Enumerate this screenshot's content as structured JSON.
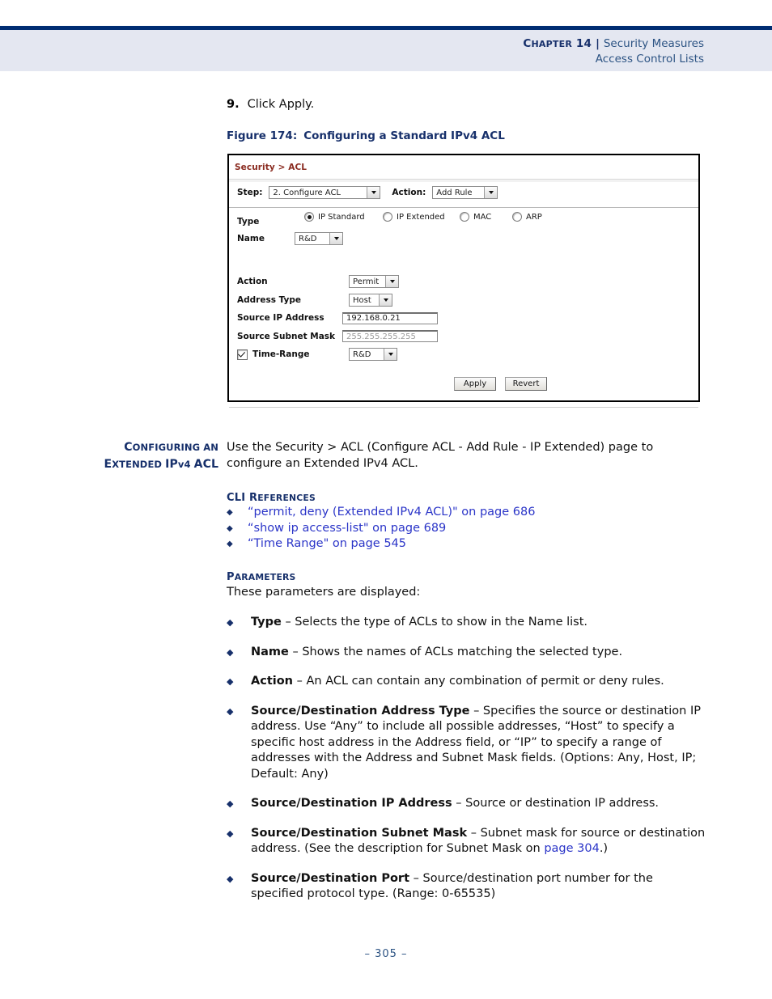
{
  "header": {
    "chapter": "CHAPTER 14",
    "separator": "|",
    "topic": "Security Measures",
    "subtopic": "Access Control Lists"
  },
  "step": {
    "number": "9.",
    "text": "Click Apply."
  },
  "figure": {
    "number": "Figure 174:",
    "title": "Configuring a Standard IPv4 ACL"
  },
  "screenshot": {
    "breadcrumb": "Security > ACL",
    "step_label": "Step:",
    "step_value": "2. Configure ACL",
    "action_label": "Action:",
    "action_value": "Add Rule",
    "type_label": "Type",
    "type_options": [
      {
        "label": "IP Standard",
        "selected": true
      },
      {
        "label": "IP Extended",
        "selected": false
      },
      {
        "label": "MAC",
        "selected": false
      },
      {
        "label": "ARP",
        "selected": false
      }
    ],
    "name_label": "Name",
    "name_value": "R&D",
    "fields": [
      {
        "label": "Action",
        "kind": "select",
        "value": "Permit",
        "width": "w-permit"
      },
      {
        "label": "Address Type",
        "kind": "select",
        "value": "Host",
        "width": "w-host"
      },
      {
        "label": "Source IP Address",
        "kind": "text",
        "value": "192.168.0.21",
        "disabled": false
      },
      {
        "label": "Source Subnet Mask",
        "kind": "text",
        "value": "255.255.255.255",
        "disabled": true
      }
    ],
    "time_range_label": "Time-Range",
    "time_range_checked": true,
    "time_range_value": "R&D",
    "apply_button": "Apply",
    "revert_button": "Revert"
  },
  "side_heading": {
    "line1": "CONFIGURING AN",
    "line2": "EXTENDED IPv4 ACL"
  },
  "intro": "Use the Security > ACL (Configure ACL - Add Rule - IP Extended) page to configure an Extended IPv4 ACL.",
  "cli_references": {
    "heading": "CLI REFERENCES",
    "items": [
      "“permit, deny (Extended IPv4 ACL)\" on page 686",
      "“show ip access-list\" on page 689",
      "“Time Range\" on page 545"
    ]
  },
  "parameters": {
    "heading": "PARAMETERS",
    "lead": "These parameters are displayed:",
    "items": [
      {
        "term": "Type",
        "desc": " – Selects the type of ACLs to show in the Name list."
      },
      {
        "term": "Name",
        "desc": " – Shows the names of ACLs matching the selected type."
      },
      {
        "term": "Action",
        "desc": " – An ACL can contain any combination of permit or deny rules."
      },
      {
        "term": "Source/Destination Address Type",
        "desc": " – Specifies the source or destination IP address. Use “Any” to include all possible addresses, “Host” to specify a specific host address in the Address field, or “IP” to specify a range of addresses with the Address and Subnet Mask fields. (Options: Any, Host, IP; Default: Any)"
      },
      {
        "term": "Source/Destination IP Address",
        "desc": " – Source or destination IP address."
      },
      {
        "term": "Source/Destination Subnet Mask",
        "desc": " – Subnet mask for source or destination address. (See the description for Subnet Mask on ",
        "link": "page 304",
        "desc_tail": ".)"
      },
      {
        "term": "Source/Destination Port",
        "desc": " – Source/destination port number for the specified protocol type. (Range: 0-65535)"
      }
    ]
  },
  "footer": "–  305  –",
  "colors": {
    "navy": "#17306b",
    "rule": "#002d72",
    "band": "#e4e7f1",
    "link": "#2b35c8",
    "crumb": "#8a2b20",
    "header_topic": "#2c5383"
  }
}
